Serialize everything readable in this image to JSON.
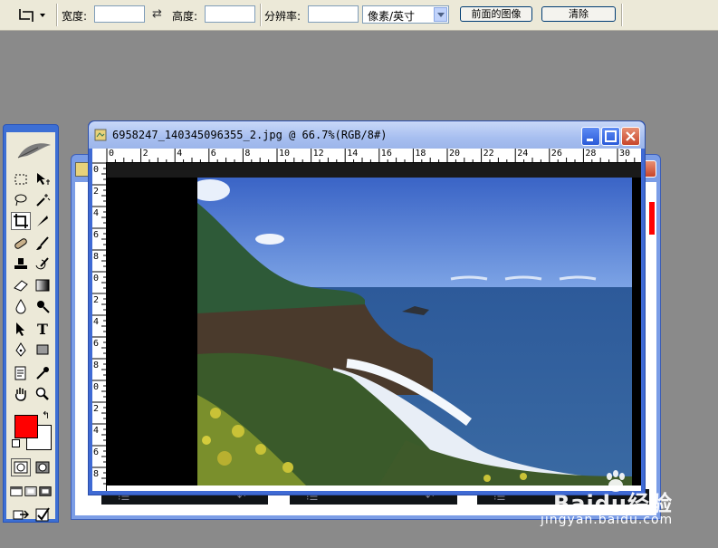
{
  "options_bar": {
    "width_label": "宽度:",
    "height_label": "高度:",
    "resolution_label": "分辨率:",
    "resolution_unit": "像素/英寸",
    "front_image_button": "前面的图像",
    "clear_button": "清除",
    "width_value": "",
    "height_value": "",
    "resolution_value": ""
  },
  "toolbox": {
    "foreground_color": "#ff0000",
    "background_color": "#ffffff",
    "active_tool": "crop-tool"
  },
  "document": {
    "title": "6958247_140345096355_2.jpg @ 66.7%(RGB/8#)",
    "ruler_h": [
      "0",
      "2",
      "4",
      "6",
      "8",
      "10",
      "12",
      "14",
      "16",
      "18",
      "20",
      "22",
      "24",
      "26",
      "28",
      "30"
    ],
    "ruler_v": [
      "0",
      "2",
      "4",
      "6",
      "8",
      "0",
      "2",
      "4",
      "6",
      "8",
      "0",
      "2",
      "4",
      "6",
      "8"
    ]
  },
  "watermark": {
    "brand": "Baidu经验",
    "url": "jingyan.baidu.com"
  }
}
